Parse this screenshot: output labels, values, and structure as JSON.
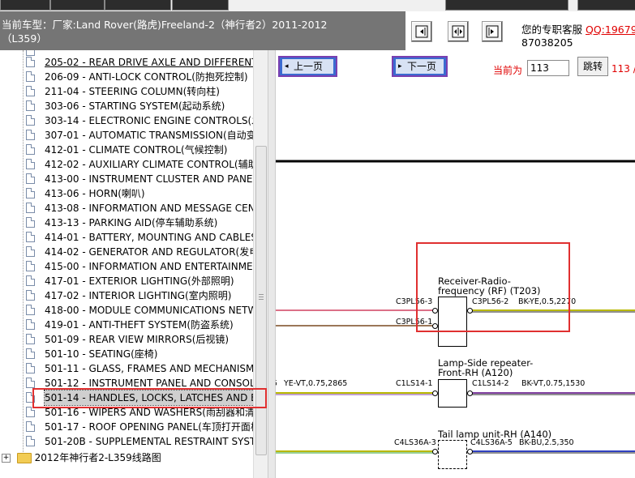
{
  "vehicle": {
    "line1": "当前车型：厂家:Land Rover(路虎)Freeland-2（神行者2）2011-2012",
    "line2": "（L359）"
  },
  "service": {
    "line1_prefix": "您的专职客服",
    "qq": "QQ:19679",
    "line2": "87038205"
  },
  "sidebar": {
    "items": [
      {
        "label": "205-02 - REAR DRIVE AXLE AND DIFFERENT"
      },
      {
        "label": "206-09 - ANTI-LOCK CONTROL(防抱死控制)"
      },
      {
        "label": "211-04 - STEERING COLUMN(转向柱)"
      },
      {
        "label": "303-06 - STARTING SYSTEM(起动系统)"
      },
      {
        "label": "303-14 - ELECTRONIC ENGINE CONTROLS(发"
      },
      {
        "label": "307-01 - AUTOMATIC TRANSMISSION(自动变"
      },
      {
        "label": "412-01 - CLIMATE CONTROL(气候控制)"
      },
      {
        "label": "412-02 - AUXILIARY CLIMATE CONTROL(辅助"
      },
      {
        "label": "413-00 - INSTRUMENT CLUSTER AND PANEL"
      },
      {
        "label": "413-06 - HORN(喇叭)"
      },
      {
        "label": "413-08 - INFORMATION AND MESSAGE CENT"
      },
      {
        "label": "413-13 - PARKING AID(停车辅助系统)"
      },
      {
        "label": "414-01 - BATTERY, MOUNTING AND CABLES"
      },
      {
        "label": "414-02 - GENERATOR AND REGULATOR(发电"
      },
      {
        "label": "415-00 - INFORMATION AND ENTERTAINMEN"
      },
      {
        "label": "417-01 - EXTERIOR LIGHTING(外部照明)"
      },
      {
        "label": "417-02 - INTERIOR LIGHTING(室内照明)"
      },
      {
        "label": "418-00 - MODULE COMMUNICATIONS NETWO"
      },
      {
        "label": "419-01 - ANTI-THEFT SYSTEM(防盗系统)"
      },
      {
        "label": "501-09 - REAR VIEW MIRRORS(后视镜)"
      },
      {
        "label": "501-10 - SEATING(座椅)"
      },
      {
        "label": "501-11 - GLASS, FRAMES AND MECHANISMS"
      },
      {
        "label": "501-12 - INSTRUMENT PANEL AND CONSOLE"
      },
      {
        "label": "501-14 - HANDLES, LOCKS, LATCHES AND E"
      },
      {
        "label": "501-16 - WIPERS AND WASHERS(雨刮器和清洗"
      },
      {
        "label": "501-17 - ROOF OPENING PANEL(车顶打开面板)"
      },
      {
        "label": "501-20B - SUPPLEMENTAL RESTRAINT SYSTE"
      }
    ],
    "selected_index": 23,
    "folder_label": "2012年神行者2-L359线路图",
    "expand_symbol": "+"
  },
  "pager": {
    "prev_label": "上一页",
    "next_label": "下一页",
    "current_label": "当前为",
    "page_value": "113",
    "goto_label": "跳转",
    "total_text": "113 /"
  },
  "diagram": {
    "components": [
      {
        "title1": "Receiver-Radio-",
        "title2": "frequency (RF) (T203)",
        "left_pins": [
          "C3PL56-3",
          "C3PL56-1"
        ],
        "right_pin": "C3PL56-2",
        "wire": "BK-YE,0.5,2270"
      },
      {
        "title1": "Lamp-Side repeater-",
        "title2": "Front-RH (A120)",
        "left_pins": [
          "C1LS14-1"
        ],
        "right_pin": "C1LS14-2",
        "wire": "BK-VT,0.75,1530",
        "left_wire": "YE-VT,0.75,2865",
        "left_wire_prefix": "5"
      },
      {
        "title1": "Tail lamp unit-RH (A140)",
        "title2": "",
        "left_pins": [
          "C4LS36A-3"
        ],
        "right_pin": "C4LS36A-5",
        "wire": "BK-BU,2.5,350"
      }
    ]
  },
  "colors": {
    "header_bg": "#757575",
    "highlight": "#e03030",
    "accent_red": "#e00000",
    "pager_border": "#7a3fb0"
  }
}
